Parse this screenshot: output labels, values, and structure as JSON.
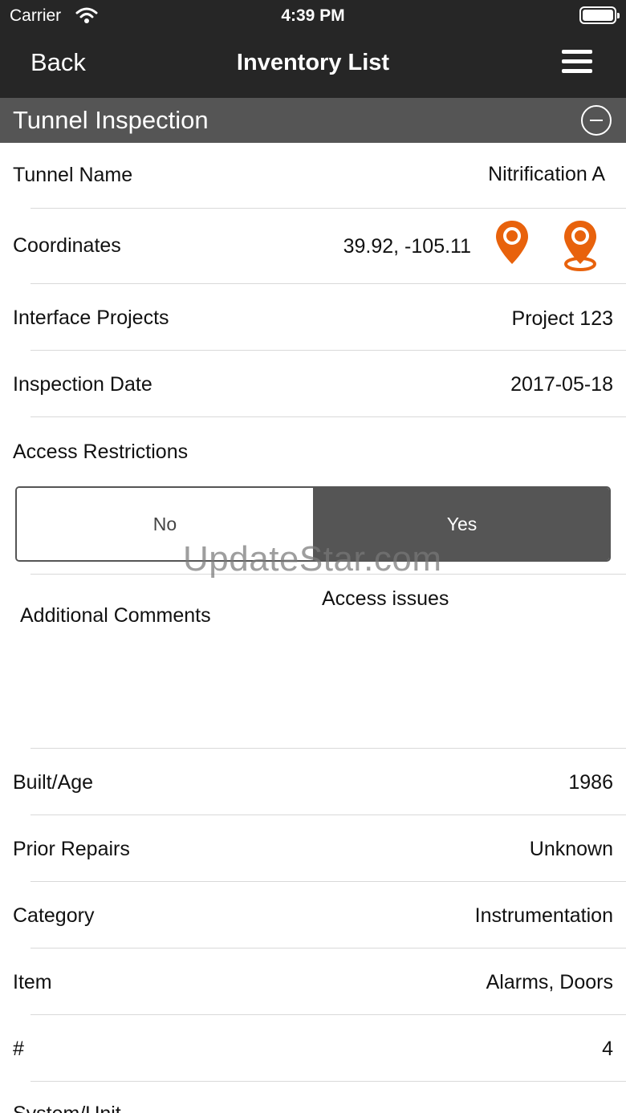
{
  "status_bar": {
    "carrier": "Carrier",
    "time": "4:39 PM"
  },
  "nav": {
    "back_label": "Back",
    "title": "Inventory List"
  },
  "section": {
    "title": "Tunnel Inspection"
  },
  "fields": {
    "tunnel_name": {
      "label": "Tunnel Name",
      "value": "Nitrification A"
    },
    "coordinates": {
      "label": "Coordinates",
      "value": "39.92, -105.11"
    },
    "interface_projects": {
      "label": "Interface Projects",
      "value": "Project 123"
    },
    "inspection_date": {
      "label": "Inspection Date",
      "value": "2017-05-18"
    },
    "access_restrictions": {
      "label": "Access Restrictions",
      "options": [
        "No",
        "Yes"
      ],
      "selected": "Yes"
    },
    "additional_comments": {
      "label": "Additional Comments",
      "value": "Access issues"
    },
    "built_age": {
      "label": "Built/Age",
      "value": "1986"
    },
    "prior_repairs": {
      "label": "Prior Repairs",
      "value": "Unknown"
    },
    "category": {
      "label": "Category",
      "value": "Instrumentation"
    },
    "item": {
      "label": "Item",
      "value": "Alarms, Doors"
    },
    "count": {
      "label": "#",
      "value": "4"
    },
    "system_unit": {
      "label": "System/Unit"
    }
  },
  "icons": {
    "location_pin": "map-pin-icon",
    "location_drop": "map-pin-drop-icon",
    "collapse": "minus-circle-icon",
    "menu": "hamburger-menu-icon"
  },
  "watermark": "UpdateStar.com",
  "colors": {
    "nav_bg": "#262626",
    "section_bg": "#555555",
    "accent_orange": "#e8620c",
    "segment_selected": "#555555"
  }
}
